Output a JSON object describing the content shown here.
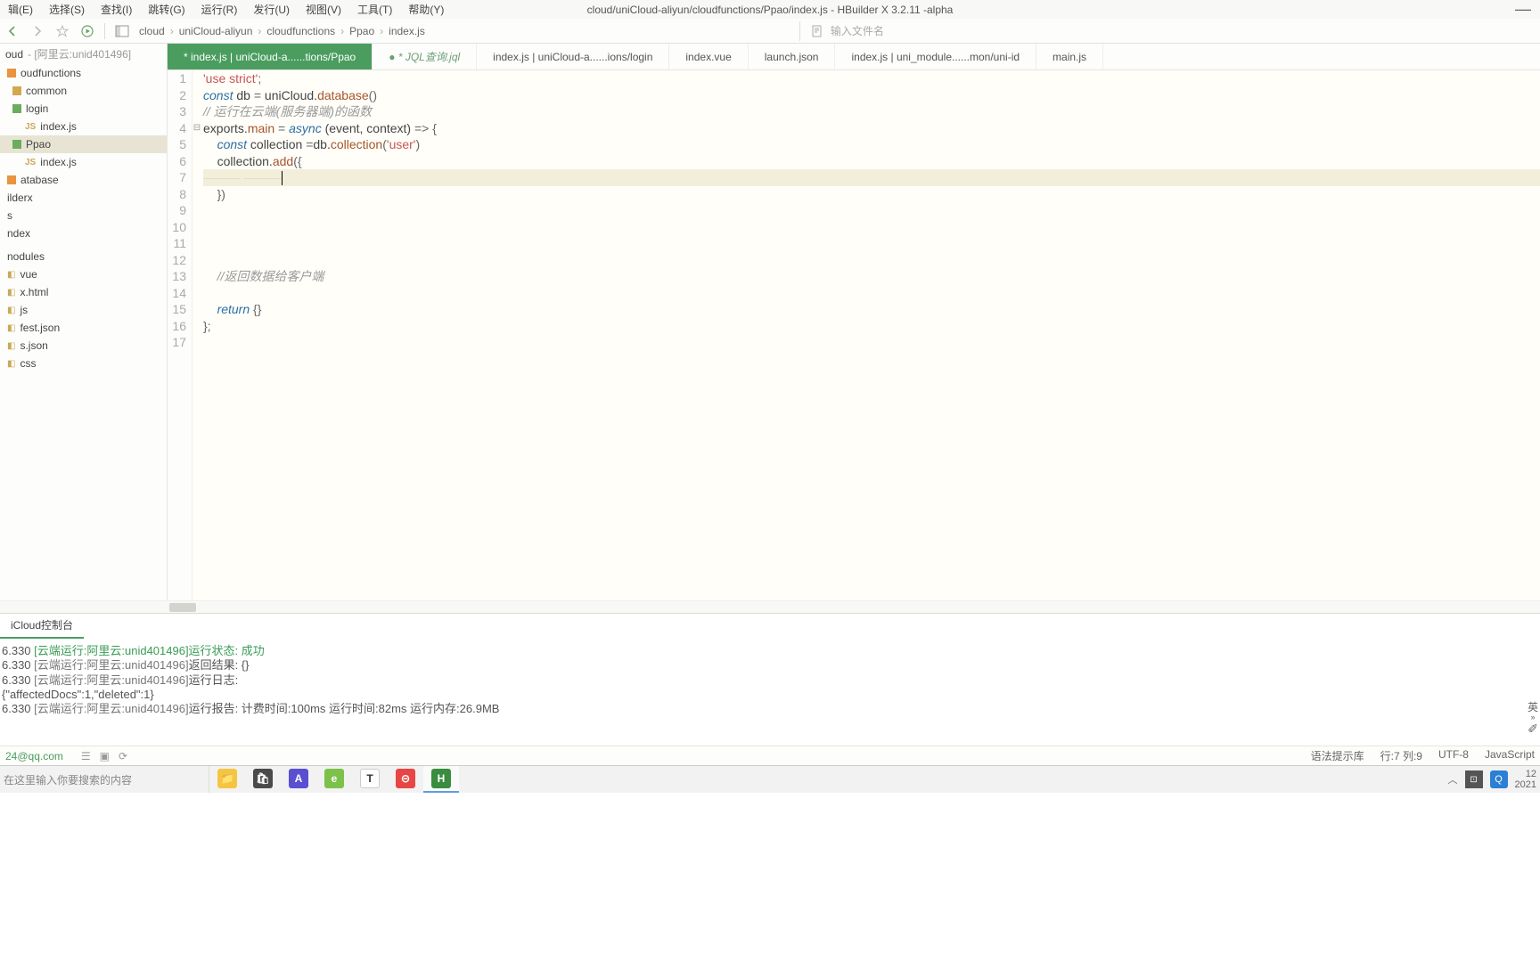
{
  "menu": [
    "辑(E)",
    "选择(S)",
    "查找(I)",
    "跳转(G)",
    "运行(R)",
    "发行(U)",
    "视图(V)",
    "工具(T)",
    "帮助(Y)"
  ],
  "window_title": "cloud/uniCloud-aliyun/cloudfunctions/Ppao/index.js - HBuilder X 3.2.11 -alpha",
  "breadcrumbs": [
    "cloud",
    "uniCloud-aliyun",
    "cloudfunctions",
    "Ppao",
    "index.js"
  ],
  "file_input_placeholder": "输入文件名",
  "sidebar": {
    "root": {
      "name": "oud",
      "suffix": " - [阿里云:unid401496]"
    },
    "items": [
      {
        "label": "oudfunctions",
        "indent": 1,
        "icon": "folder-orange"
      },
      {
        "label": "common",
        "indent": 2,
        "icon": "folder"
      },
      {
        "label": "login",
        "indent": 2,
        "icon": "folder-green"
      },
      {
        "label": "index.js",
        "indent": 3,
        "icon": "js"
      },
      {
        "label": "Ppao",
        "indent": 2,
        "icon": "folder-green",
        "selected": true
      },
      {
        "label": "index.js",
        "indent": 3,
        "icon": "js"
      },
      {
        "label": "atabase",
        "indent": 1,
        "icon": "folder-orange"
      },
      {
        "label": "ilderx",
        "indent": 1,
        "icon": "none"
      },
      {
        "label": "s",
        "indent": 1,
        "icon": "none"
      },
      {
        "label": "ndex",
        "indent": 1,
        "icon": "none"
      },
      {
        "label": "",
        "indent": 1,
        "icon": "none"
      },
      {
        "label": "nodules",
        "indent": 1,
        "icon": "none"
      },
      {
        "label": "vue",
        "indent": 1,
        "icon": "file"
      },
      {
        "label": "x.html",
        "indent": 1,
        "icon": "file"
      },
      {
        "label": "js",
        "indent": 1,
        "icon": "file"
      },
      {
        "label": "fest.json",
        "indent": 1,
        "icon": "file"
      },
      {
        "label": "s.json",
        "indent": 1,
        "icon": "file"
      },
      {
        "label": "css",
        "indent": 1,
        "icon": "file"
      }
    ]
  },
  "tabs": [
    {
      "label": "* index.js | uniCloud-a......tions/Ppao",
      "active": true
    },
    {
      "label": "● * JQL查询.jql",
      "italic": true
    },
    {
      "label": "index.js | uniCloud-a......ions/login"
    },
    {
      "label": "index.vue"
    },
    {
      "label": "launch.json"
    },
    {
      "label": "index.js | uni_module......mon/uni-id"
    },
    {
      "label": "main.js"
    }
  ],
  "editor": {
    "line_numbers": [
      "1",
      "2",
      "3",
      "4",
      "5",
      "6",
      "7",
      "8",
      "9",
      "10",
      "11",
      "12",
      "13",
      "14",
      "15",
      "16",
      "17"
    ],
    "fold": {
      "4": "⊟"
    },
    "cursor_line": 7,
    "code": {
      "l1_str": "'use strict'",
      "l1_sc": ";",
      "l2_kw": "const",
      "l2_id": " db ",
      "l2_op": "=",
      "l2_id2": " uniCloud.",
      "l2_fn": "database",
      "l2_paren": "()",
      "l3": "// 运行在云端(服务器端)的函数",
      "l4_a": "exports.",
      "l4_b": "main",
      "l4_c": " = ",
      "l4_d": "async",
      "l4_e": " (event, context) ",
      "l4_f": "=>",
      "l4_g": " {",
      "l5_kw": "const",
      "l5_id": " collection ",
      "l5_op": "=",
      "l5_id2": "db.",
      "l5_fn": "collection",
      "l5_p1": "(",
      "l5_str": "'user'",
      "l5_p2": ")",
      "l6_a": "collection.",
      "l6_fn": "add",
      "l6_b": "({",
      "l8": "})",
      "l13": "//返回数据给客户端",
      "l15_kw": "return",
      "l15_b": " {}",
      "l16": "};"
    }
  },
  "console": {
    "tab": "iCloud控制台",
    "lines": [
      {
        "pre": "6.330 ",
        "green": "[云端运行:阿里云:unid401496]运行状态: 成功"
      },
      {
        "pre": "6.330 ",
        "gray": "[云端运行:阿里云:unid401496]",
        "rest": "返回结果: {}"
      },
      {
        "pre": "6.330 ",
        "gray": "[云端运行:阿里云:unid401496]",
        "rest": "运行日志:"
      },
      {
        "pre": "",
        "rest": " {\"affectedDocs\":1,\"deleted\":1}"
      },
      {
        "pre": "6.330 ",
        "gray": "[云端运行:阿里云:unid401496]",
        "rest": "运行报告: 计费时间:100ms 运行时间:82ms 运行内存:26.9MB"
      }
    ]
  },
  "status": {
    "email": "24@qq.com",
    "syntax": "语法提示库",
    "pos": "行:7  列:9",
    "enc": "UTF-8",
    "lang": "JavaScript"
  },
  "taskbar": {
    "search": "在这里输入你要搜索的内容",
    "time1": "12",
    "time2": "2021"
  },
  "ime": "英"
}
